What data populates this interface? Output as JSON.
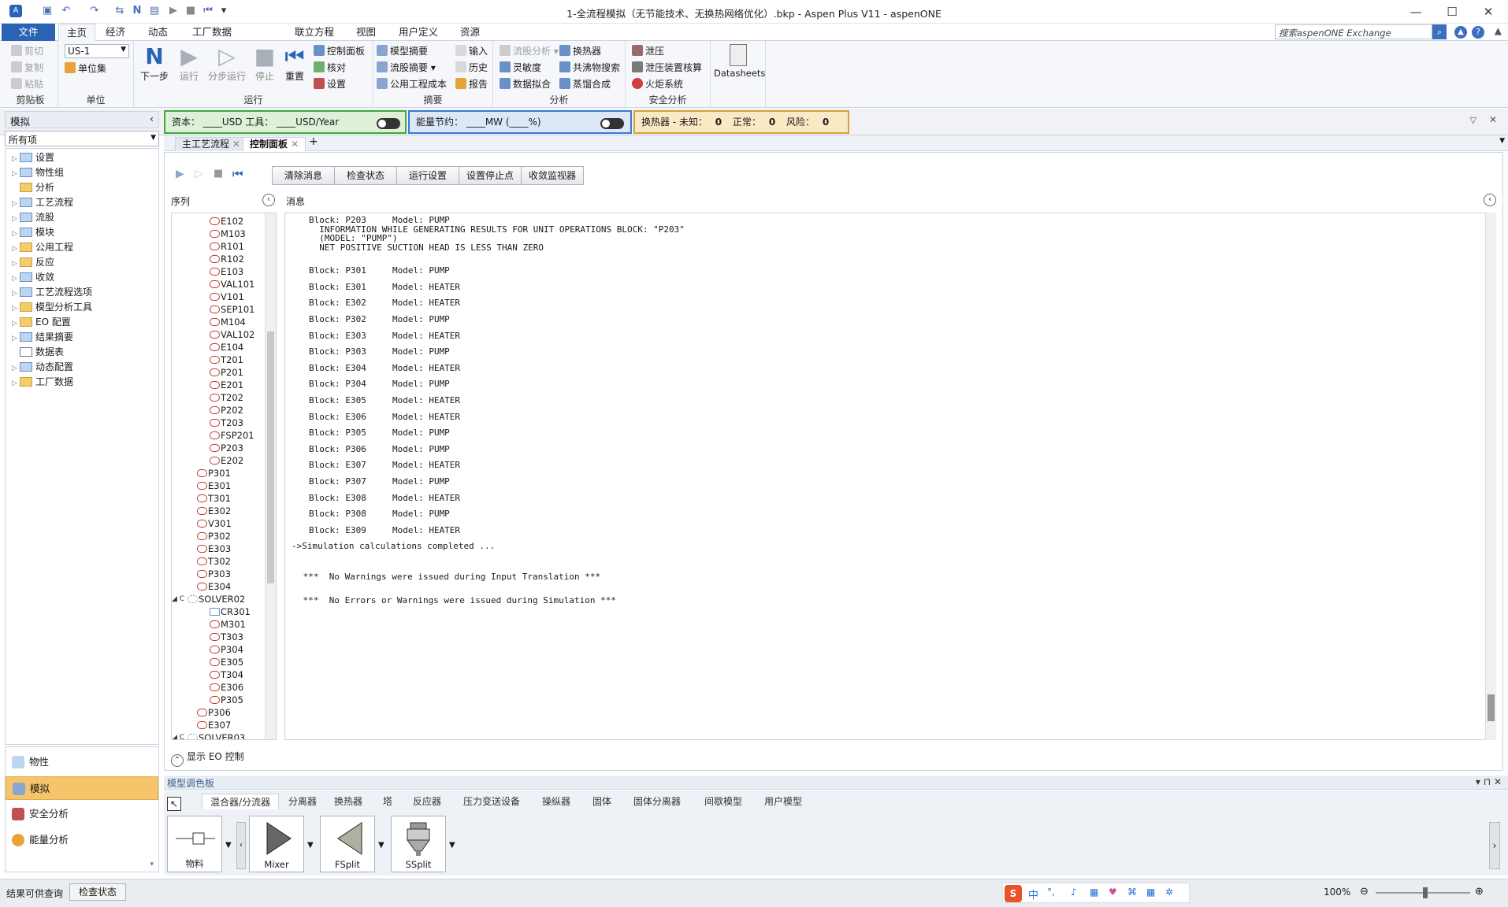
{
  "titlebar": {
    "title": "1-全流程模拟（无节能技术、无换热网络优化）.bkp - Aspen Plus V11 - aspenONE",
    "minimize": "—",
    "maximize": "☐",
    "close": "✕"
  },
  "menu": {
    "tabs": [
      "文件",
      "主页",
      "经济",
      "动态",
      "工厂数据",
      "联立方程",
      "视图",
      "用户定义",
      "资源"
    ],
    "active": "主页",
    "search_placeholder": "搜索aspenONE Exchange"
  },
  "ribbon": {
    "clipboard": {
      "cut": "剪切",
      "copy": "复制",
      "paste": "粘贴",
      "label": "剪贴板"
    },
    "units": {
      "unitset": "US-1",
      "unitset_label": "单位集",
      "label": "单位"
    },
    "run": {
      "next": "下一步",
      "run": "运行",
      "step": "分步运行",
      "stop": "停止",
      "reset": "重置",
      "control_panel": "控制面板",
      "check": "核对",
      "settings": "设置",
      "label": "运行"
    },
    "summary": {
      "model_summary": "模型摘要",
      "stream_summary": "流股摘要",
      "utility_cost": "公用工程成本",
      "input": "输入",
      "history": "历史",
      "report": "报告",
      "label": "摘要"
    },
    "analysis": {
      "stream_analysis": "流股分析",
      "sensitivity": "灵敏度",
      "data_fit": "数据拟合",
      "heat_exchanger": "换热器",
      "azeotrope_search": "共沸物搜索",
      "distillation_synthesis": "蒸馏合成",
      "label": "分析"
    },
    "safety": {
      "relief": "泄压",
      "relief_sizing": "泄压装置核算",
      "flare": "火炬系统",
      "label": "安全分析"
    },
    "datasheets": "Datasheets"
  },
  "status_row": {
    "capital": "资本：  ____USD   工具：  ____USD/Year",
    "energy": "能量节约：  ____MW   (____%)",
    "hx": [
      "换热器 - 未知：",
      "0",
      "正常：",
      "0",
      "风险：",
      "0"
    ]
  },
  "nav": {
    "header": "模拟",
    "filter": "所有项",
    "items": [
      "设置",
      "物性组",
      "分析",
      "工艺流程",
      "流股",
      "模块",
      "公用工程",
      "反应",
      "收敛",
      "工艺流程选项",
      "模型分析工具",
      "EO 配置",
      "结果摘要",
      "数据表",
      "动态配置",
      "工厂数据"
    ],
    "bottom": [
      "物性",
      "模拟",
      "安全分析",
      "能量分析"
    ],
    "bottom_selected": "模拟"
  },
  "doctabs": [
    "主工艺流程",
    "控制面板"
  ],
  "doctab_active": "控制面板",
  "control": {
    "buttons": [
      "清除消息",
      "检查状态",
      "运行设置",
      "设置停止点",
      "收敛监视器"
    ],
    "seq_header": "序列",
    "msg_header": "消息",
    "show_eo": "显示 EO 控制",
    "sequence": [
      {
        "name": "E102",
        "lvl": 2
      },
      {
        "name": "M103",
        "lvl": 2
      },
      {
        "name": "R101",
        "lvl": 2
      },
      {
        "name": "R102",
        "lvl": 2
      },
      {
        "name": "E103",
        "lvl": 2
      },
      {
        "name": "VAL101",
        "lvl": 2
      },
      {
        "name": "V101",
        "lvl": 2
      },
      {
        "name": "SEP101",
        "lvl": 2
      },
      {
        "name": "M104",
        "lvl": 2
      },
      {
        "name": "VAL102",
        "lvl": 2
      },
      {
        "name": "E104",
        "lvl": 2
      },
      {
        "name": "T201",
        "lvl": 2
      },
      {
        "name": "P201",
        "lvl": 2
      },
      {
        "name": "E201",
        "lvl": 2
      },
      {
        "name": "T202",
        "lvl": 2
      },
      {
        "name": "P202",
        "lvl": 2
      },
      {
        "name": "T203",
        "lvl": 2
      },
      {
        "name": "FSP201",
        "lvl": 2
      },
      {
        "name": "P203",
        "lvl": 2
      },
      {
        "name": "E202",
        "lvl": 2
      },
      {
        "name": "P301",
        "lvl": 1
      },
      {
        "name": "E301",
        "lvl": 1
      },
      {
        "name": "T301",
        "lvl": 1
      },
      {
        "name": "E302",
        "lvl": 1
      },
      {
        "name": "V301",
        "lvl": 1
      },
      {
        "name": "P302",
        "lvl": 1
      },
      {
        "name": "E303",
        "lvl": 1
      },
      {
        "name": "T302",
        "lvl": 1
      },
      {
        "name": "P303",
        "lvl": 1
      },
      {
        "name": "E304",
        "lvl": 1
      },
      {
        "name": "SOLVER02",
        "lvl": 0
      },
      {
        "name": "CR301",
        "lvl": 2
      },
      {
        "name": "M301",
        "lvl": 2
      },
      {
        "name": "T303",
        "lvl": 2
      },
      {
        "name": "P304",
        "lvl": 2
      },
      {
        "name": "E305",
        "lvl": 2
      },
      {
        "name": "T304",
        "lvl": 2
      },
      {
        "name": "E306",
        "lvl": 2
      },
      {
        "name": "P305",
        "lvl": 2
      },
      {
        "name": "P306",
        "lvl": 1
      },
      {
        "name": "E307",
        "lvl": 1
      },
      {
        "name": "SOLVER03",
        "lvl": 0
      }
    ],
    "messages": [
      "Block: P203     Model: PUMP",
      "  INFORMATION WHILE GENERATING RESULTS FOR UNIT OPERATIONS BLOCK: \"P203\"",
      "  (MODEL: \"PUMP\")",
      "  NET POSITIVE SUCTION HEAD IS LESS THAN ZERO",
      "",
      "",
      "Block: P301     Model: PUMP",
      "",
      "Block: E301     Model: HEATER",
      "",
      "Block: E302     Model: HEATER",
      "",
      "Block: P302     Model: PUMP",
      "",
      "Block: E303     Model: HEATER",
      "",
      "Block: P303     Model: PUMP",
      "",
      "Block: E304     Model: HEATER",
      "",
      "Block: P304     Model: PUMP",
      "",
      "Block: E305     Model: HEATER",
      "",
      "Block: E306     Model: HEATER",
      "",
      "Block: P305     Model: PUMP",
      "",
      "Block: P306     Model: PUMP",
      "",
      "Block: E307     Model: HEATER",
      "",
      "Block: P307     Model: PUMP",
      "",
      "Block: E308     Model: HEATER",
      "",
      "Block: P308     Model: PUMP",
      "",
      "Block: E309     Model: HEATER",
      "",
      "->Simulation calculations completed ...",
      "",
      "",
      "",
      " ***  No Warnings were issued during Input Translation ***",
      "",
      "",
      " ***  No Errors or Warnings were issued during Simulation ***"
    ]
  },
  "palette": {
    "header": "模型调色板",
    "tabs": [
      "混合器/分流器",
      "分离器",
      "换热器",
      "塔",
      "反应器",
      "压力变送设备",
      "操纵器",
      "固体",
      "固体分离器",
      "间歇模型",
      "用户模型"
    ],
    "active": "混合器/分流器",
    "items": [
      "物料",
      "Mixer",
      "FSplit",
      "SSplit"
    ]
  },
  "statusbar": {
    "left": "结果可供查询",
    "check": "检查状态",
    "zoom": "100%",
    "ime": [
      "中",
      "°,",
      "♪",
      "▦",
      "♥",
      "⌘",
      "▦",
      "✲"
    ]
  },
  "colors": {
    "accent": "#2b63b4",
    "selected": "#f6c56b",
    "capital_border": "#3fa83f",
    "energy_border": "#3b7ad6",
    "hx_border": "#d4a23a"
  }
}
